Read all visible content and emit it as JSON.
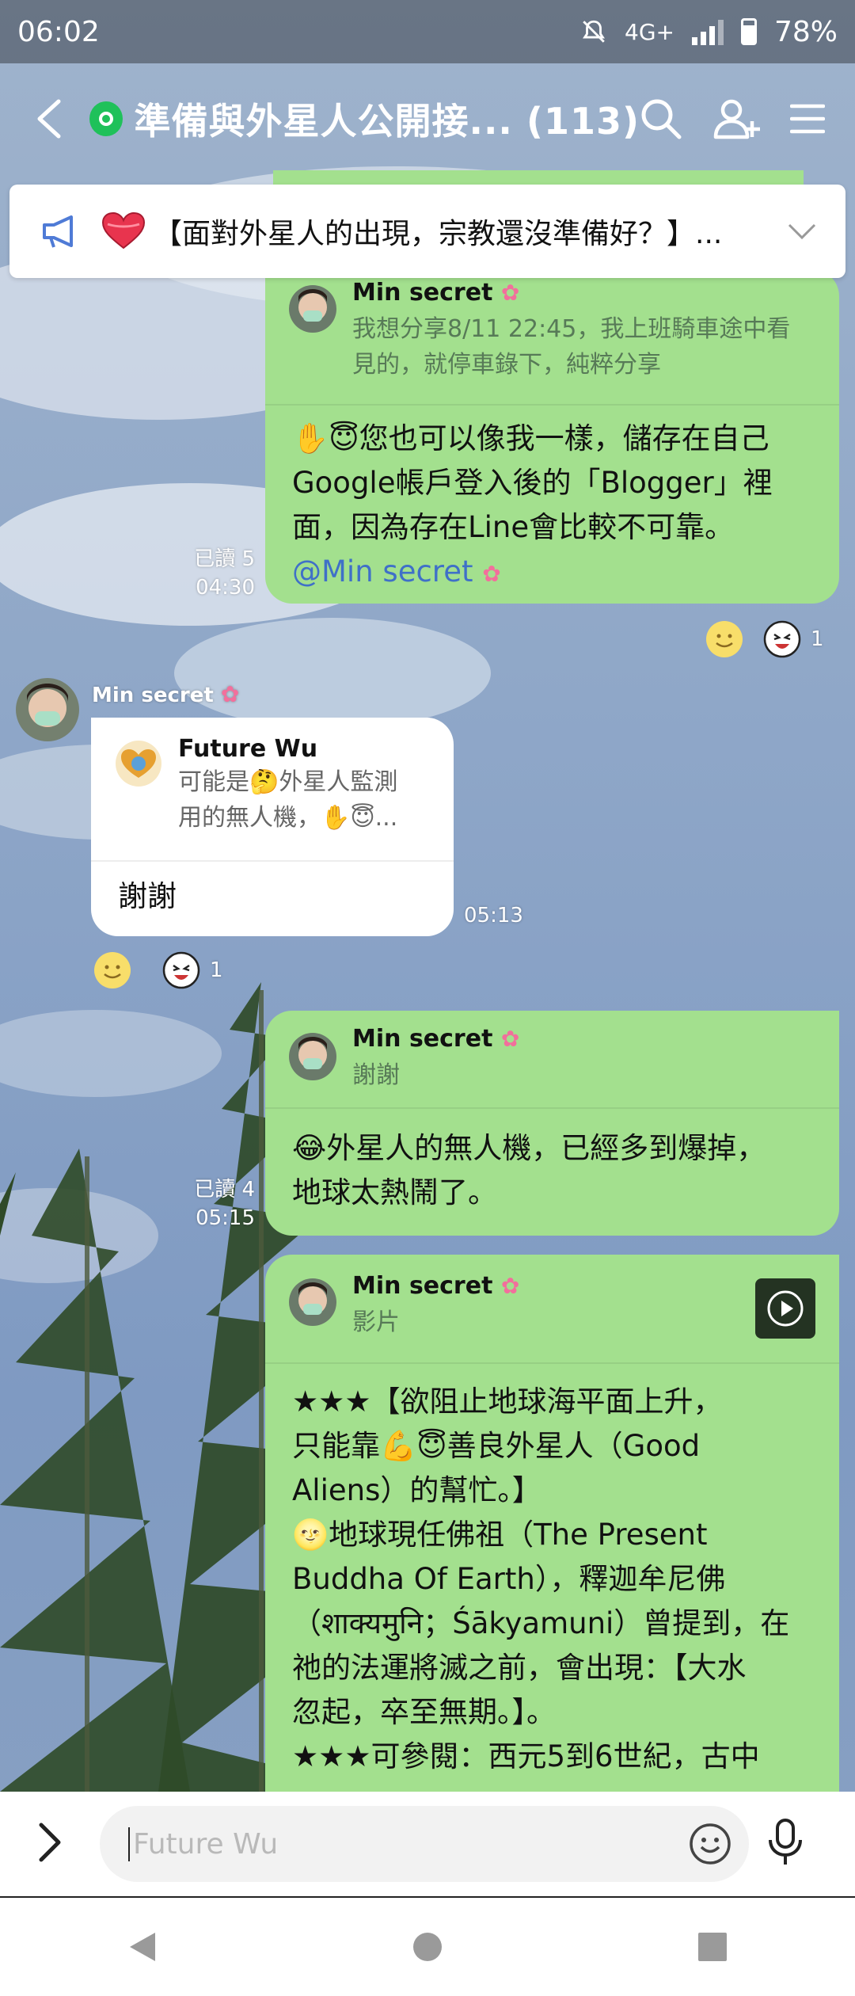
{
  "status_bar": {
    "time": "06:02",
    "network": "4G+",
    "battery": "78%"
  },
  "header": {
    "title": "準備與外星人公開接... (113)"
  },
  "announcement": {
    "text": "【面對外星人的出現，宗教還沒準備好？】..."
  },
  "messages": [
    {
      "quote_name": "Min secret",
      "quote_text_1": "我想分享8/11 22:45，我上班騎車途中看",
      "quote_text_2": "見的，就停車錄下，純粹分享",
      "line_1": "您也可以像我一樣，儲存在自己",
      "line_2": "Google帳戶登入後的「Blogger」裡",
      "line_3": "面，因為存在Line會比較不可靠。",
      "mention": "@Min secret",
      "read": "已讀 5",
      "time": "04:30",
      "reaction_count": "1"
    },
    {
      "sender": "Min secret",
      "quote_name": "Future Wu",
      "quote_text_1": "可能是",
      "quote_text_1b": "外星人監測",
      "quote_text_2": "用的無人機，",
      "quote_text_2b": "...",
      "text": "謝謝",
      "time": "05:13",
      "reaction_count": "1"
    },
    {
      "quote_name": "Min secret",
      "quote_text": "謝謝",
      "line_1": "外星人的無人機，已經多到爆掉，",
      "line_2": "地球太熱鬧了。",
      "read": "已讀 4",
      "time": "05:15"
    },
    {
      "quote_name": "Min secret",
      "quote_text": "影片",
      "line_1": "★★★【欲阻止地球海平面上升，",
      "line_2a": "只能靠",
      "line_2b": "善良外星人（Good",
      "line_3": "Aliens）的幫忙。】",
      "line_4": "地球現任佛祖（The Present",
      "line_5": "Buddha Of Earth），釋迦牟尼佛",
      "line_6": "（शाक्यमुनि；Śākyamuni）曾提到，在",
      "line_7": "祂的法運將滅之前，會出現：【大水",
      "line_8": "忽起，卒至無期。】。",
      "line_9": "★★★可參閱：西元5到6世紀，古中"
    }
  ],
  "input": {
    "placeholder": "Future Wu"
  },
  "colors": {
    "bubble_green": "#a3e08e",
    "line_green": "#1fc15a",
    "mention_blue": "#3f70c8"
  }
}
